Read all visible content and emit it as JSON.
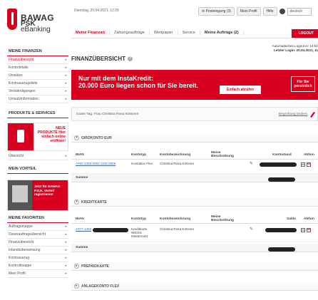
{
  "logo": {
    "line1": "BAWAG",
    "line2": "PSK",
    "line3": "eBanking"
  },
  "topbar": {
    "date": "Dienstag, 20.04.2021, 12:25",
    "postbox": "Posteingang (3)",
    "profile": "Mein Profil",
    "help": "Hilfe",
    "language": "deutsch"
  },
  "nav": {
    "items": [
      "Meine Finanzen",
      "Zahlungsaufträge",
      "Wertpapier",
      "Service",
      "Meine Aufträge (2)"
    ],
    "logout": "LOGOUT"
  },
  "sidebar": {
    "finanzen_head": "MEINE FINANZEN",
    "finanzen_items": [
      "Finanzübersicht",
      "Kontodetails",
      "Umsätze",
      "Kontoauszugsliste",
      "Verständigungen",
      "Umsatzinformation"
    ],
    "produkte_head": "PRODUKTE & SERVICES",
    "promo_text": "NEUE PRODUKTE Hier einfach online eröffnen!",
    "uebersicht": "Übersicht",
    "vorteil_head": "MEIN VORTEIL",
    "vorteil_text": "Jetzt für BAWAG P.S.K. Vorteil registrieren!",
    "favoriten_head": "MEINE FAVORITEN",
    "favoriten_items": [
      "Auftragsmappe",
      "Dauerauftragsübersicht",
      "Finanzübersicht",
      "Inlandsüberweisung",
      "Kontoauszug",
      "Kontrollmappe",
      "Mein Profil"
    ]
  },
  "content": {
    "title": "FINANZÜBERSICHT",
    "login_info_1": "Automatisches Logout in: 14:51",
    "login_info_2": "Letzter Login: 20.04.2021, 11",
    "banner": {
      "line1": "Nur mit dem InstaKredit:",
      "line2": "20.000 Euro liegen schon für Sie bereit.",
      "cta": "Einfach abrufen",
      "side": "Für Sie persönlich"
    },
    "greeting": "Guten Tag, Frau Christina Rosa Kössner!",
    "greeting_link": "Begrüßung ändern",
    "sections": {
      "giro": "GIROKONTO EUR",
      "kredit": "KREDITKARTE",
      "prepaid": "PREPAIDKARTE",
      "anlage": "ANLAGEKONTO FLEX"
    },
    "giro_table": {
      "headers": [
        "IBAN",
        "Kontotyp",
        "Kontobezeichnung",
        "Meine Beschreibung",
        "Kontostand",
        "Aktion"
      ],
      "row": {
        "iban": "AT50 1400 0050 1105 0059",
        "typ": "KontoBox Flex",
        "bez": "Christina Rosa Kössner"
      },
      "summe": "Summe"
    },
    "kredit_table": {
      "headers": [
        "IBAN",
        "Kontotyp",
        "Kontobezeichnung",
        "Meine Beschreibung",
        "Saldo",
        "Aktion"
      ],
      "row": {
        "iban": "AT77 1400",
        "typ": "Kreditkarte WEISS Mastercard",
        "bez": "Christina Rosa Kössner"
      },
      "summe": "Summe"
    }
  },
  "colors": {
    "brand": "#d8001e"
  }
}
